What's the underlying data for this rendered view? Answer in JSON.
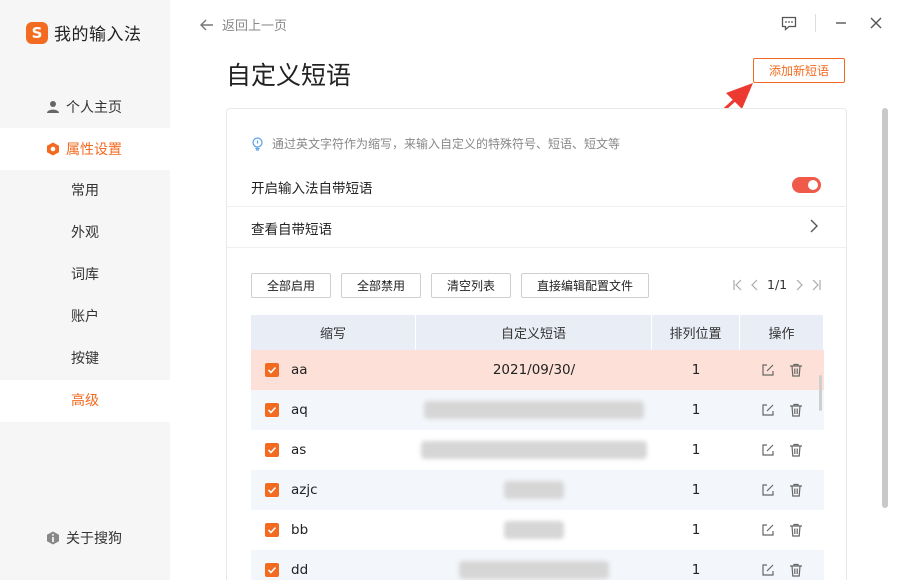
{
  "app": {
    "name": "我的输入法",
    "logo_letter": "S"
  },
  "sidebar": {
    "profile": "个人主页",
    "settings": "属性设置",
    "subitems": [
      "常用",
      "外观",
      "词库",
      "账户",
      "按键",
      "高级"
    ],
    "about": "关于搜狗"
  },
  "topbar": {
    "back": "返回上一页"
  },
  "page": {
    "title": "自定义短语",
    "add_button": "添加新短语",
    "hint": "通过英文字符作为缩写，来输入自定义的特殊符号、短语、短文等",
    "enable_builtin": "开启输入法自带短语",
    "view_builtin": "查看自带短语",
    "toggle_on": true
  },
  "toolbar": {
    "enable_all": "全部启用",
    "disable_all": "全部禁用",
    "clear_list": "清空列表",
    "edit_config": "直接编辑配置文件",
    "page_indicator": "1/1"
  },
  "table": {
    "headers": [
      "缩写",
      "自定义短语",
      "排列位置",
      "操作"
    ],
    "rows": [
      {
        "abbr": "aa",
        "phrase": "2021/09/30/",
        "pos": "1"
      },
      {
        "abbr": "aq",
        "phrase": "",
        "pos": "1"
      },
      {
        "abbr": "as",
        "phrase": "",
        "pos": "1"
      },
      {
        "abbr": "azjc",
        "phrase": "",
        "pos": "1"
      },
      {
        "abbr": "bb",
        "phrase": "",
        "pos": "1"
      },
      {
        "abbr": "dd",
        "phrase": "",
        "pos": "1"
      }
    ]
  },
  "colors": {
    "accent": "#f26b21",
    "toggle": "#f05a4a",
    "selected_row": "#fde1d8"
  }
}
